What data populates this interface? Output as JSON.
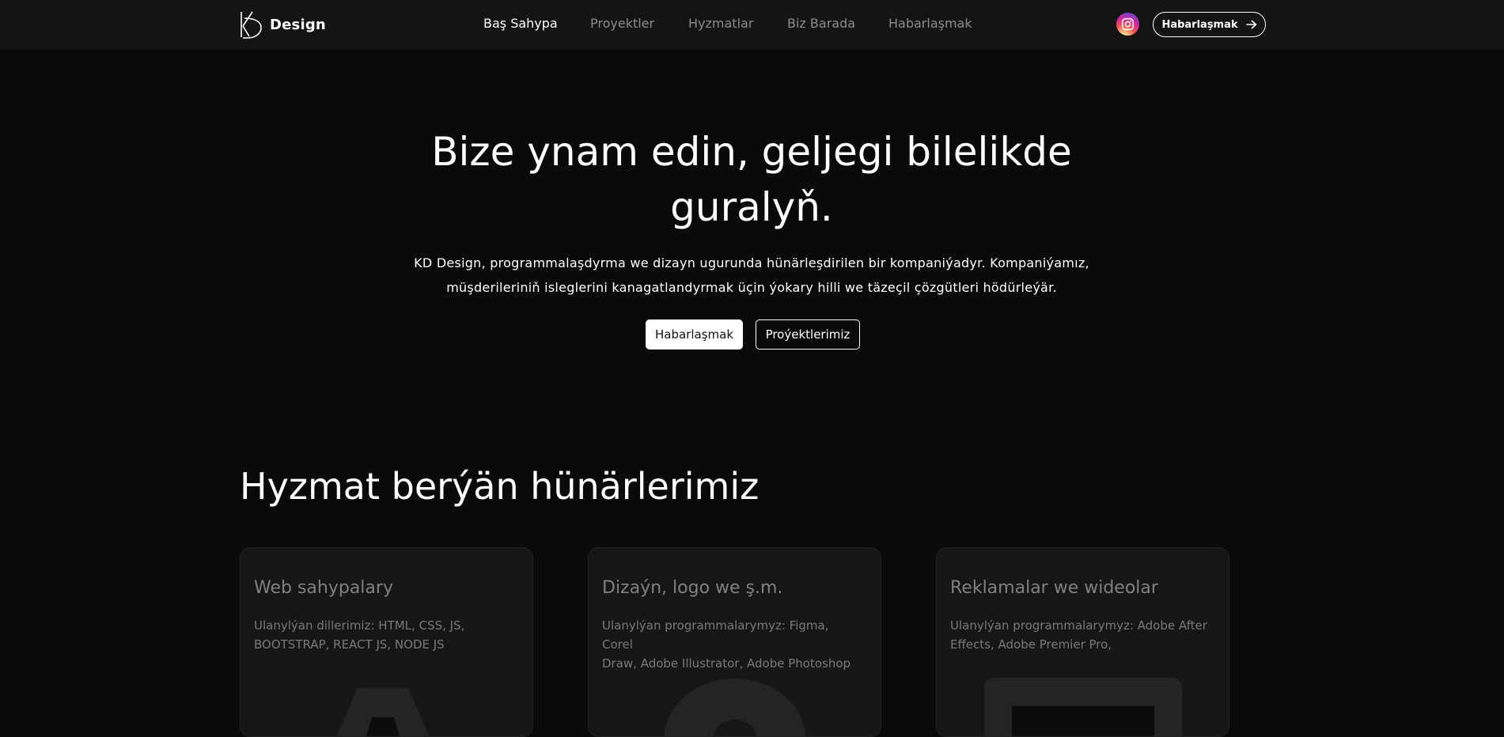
{
  "navbar": {
    "brand": {
      "text": "Design",
      "logo_icon": "kd-logo-icon"
    },
    "links": [
      {
        "label": "Baş Sahypa",
        "active": true
      },
      {
        "label": "Proyektler",
        "active": false
      },
      {
        "label": "Hyzmatlar",
        "active": false
      },
      {
        "label": "Biz Barada",
        "active": false
      },
      {
        "label": "Habarlaşmak",
        "active": false
      }
    ],
    "social_icon": "instagram-icon",
    "cta_label": "Habarlaşmak",
    "cta_icon": "arrow-right-icon"
  },
  "hero": {
    "title_line1": "Bize ynam edin, geljegi bilelikde",
    "title_line2": "guralyň.",
    "subtitle_line1": "KD Design, programmalaşdyrma we dizayn ugurunda hünärleşdirilen bir kompaniýadyr. Kompaniýamız,",
    "subtitle_line2": "müşderileriniň isleglerini kanagatlandyrmak üçin ýokary hilli we täzeçil çözgütleri hödürleýär.",
    "primary_button": "Habarlaşmak",
    "secondary_button": "Proýektlerimiz"
  },
  "services": {
    "title": "Hyzmat berýän hünärlerimiz",
    "cards": [
      {
        "title": "Web sahypalary",
        "text_line1": "Ulanylýan dillerimiz: HTML, CSS, JS,",
        "text_line2": "BOOTSTRAP, REACT JS, NODE JS",
        "icon": "code-icon"
      },
      {
        "title": "Dizaýn, logo we ş.m.",
        "text_line1": "Ulanylýan programmalarymyz: Figma, Corel",
        "text_line2": "Draw, Adobe Illustrator, Adobe Photoshop",
        "icon": "design-icon"
      },
      {
        "title": "Reklamalar we wideolar",
        "text_line1": "Ulanylýan programmalarymyz: Adobe After",
        "text_line2": "Effects, Adobe Premier Pro,",
        "icon": "video-icon"
      }
    ]
  },
  "colors": {
    "background": "#0a0a0a",
    "navbar": "#141414",
    "card": "#161616",
    "muted_text": "#808080",
    "link_inactive": "#8c8c8c"
  }
}
